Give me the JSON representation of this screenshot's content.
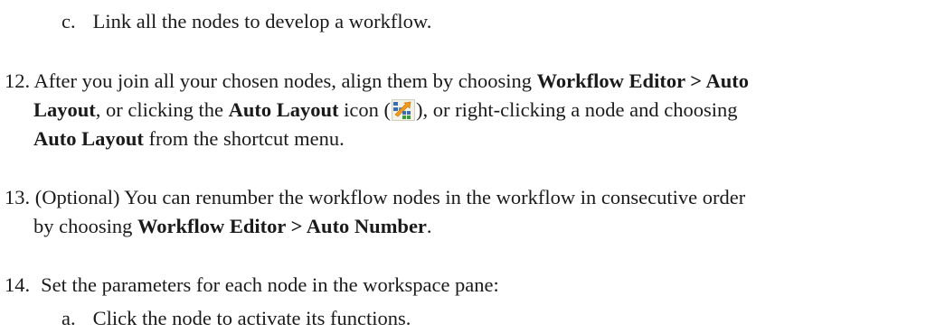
{
  "sub_c": {
    "marker": "c.",
    "text": "Link all the nodes to develop a workflow."
  },
  "step12": {
    "number": "12.",
    "t1": "After you join all your chosen nodes, align them by choosing ",
    "b1": "Workflow Editor > Auto",
    "b2": "Layout",
    "t2": ", or clicking the ",
    "b3": "Auto Layout",
    "t3": " icon (",
    "t4": "), or right-clicking a node and choosing",
    "b4": "Auto Layout",
    "t5": " from the shortcut menu.",
    "icon": "auto-layout-icon"
  },
  "step13": {
    "number": "13.",
    "t1": "(Optional) You can renumber the workflow nodes in the workflow in consecutive order",
    "t2": "by choosing ",
    "b1": "Workflow Editor > Auto Number",
    "t3": "."
  },
  "step14": {
    "number": "14.",
    "text": "Set the parameters for each node in the workspace pane:"
  },
  "sub_a": {
    "marker": "a.",
    "text": "Click the node to activate its functions."
  }
}
